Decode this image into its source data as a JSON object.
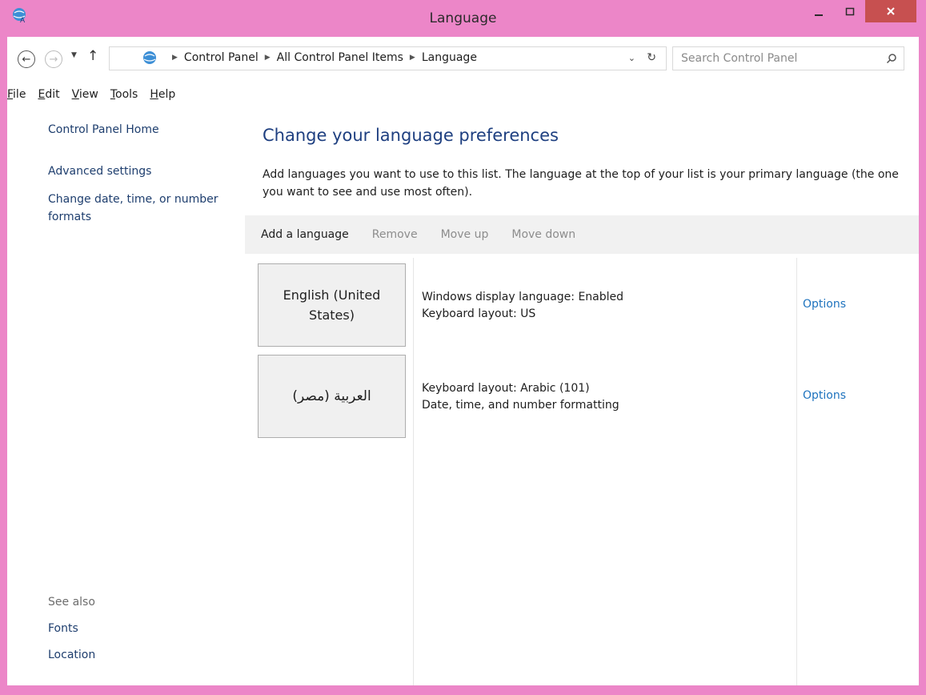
{
  "window": {
    "title": "Language",
    "colors": {
      "frame": "#ec86c8",
      "close_button": "#c75050",
      "heading": "#1e3f80",
      "link": "#1e73be"
    }
  },
  "navigation": {
    "back_icon": "back-arrow-icon",
    "forward_icon": "forward-arrow-icon",
    "up_icon": "up-arrow-icon",
    "recent_icon": "chevron-down-icon"
  },
  "address": {
    "breadcrumb": [
      "Control Panel",
      "All Control Panel Items",
      "Language"
    ],
    "search_placeholder": "Search Control Panel"
  },
  "menu": {
    "items": [
      {
        "accel": "F",
        "rest": "ile"
      },
      {
        "accel": "E",
        "rest": "dit"
      },
      {
        "accel": "V",
        "rest": "iew"
      },
      {
        "accel": "T",
        "rest": "ools"
      },
      {
        "accel": "H",
        "rest": "elp"
      }
    ]
  },
  "sidebar": {
    "home": "Control Panel Home",
    "advanced": "Advanced settings",
    "date_formats": "Change date, time, or number formats",
    "see_also_label": "See also",
    "fonts": "Fonts",
    "location": "Location"
  },
  "main": {
    "title": "Change your language preferences",
    "description": "Add languages you want to use to this list. The language at the top of your list is your primary language (the one you want to see and use most often).",
    "toolbar": {
      "add": "Add a language",
      "remove": "Remove",
      "move_up": "Move up",
      "move_down": "Move down"
    },
    "languages": [
      {
        "name": "English (United States)",
        "info_line1": "Windows display language: Enabled",
        "info_line2": "Keyboard layout: US",
        "options": "Options"
      },
      {
        "name": "العربية (مصر)",
        "info_line1": "Keyboard layout: Arabic (101)",
        "info_line2": "Date, time, and number formatting",
        "options": "Options"
      }
    ]
  }
}
